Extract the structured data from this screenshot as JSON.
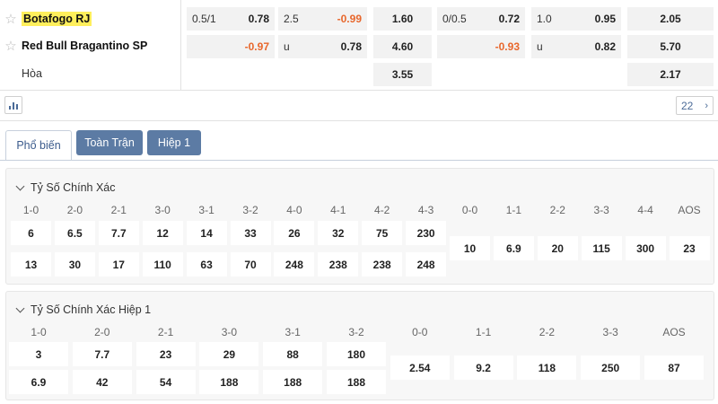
{
  "teams": [
    {
      "name": "Botafogo RJ",
      "highlight": true
    },
    {
      "name": "Red Bull Bragantino SP",
      "highlight": false
    }
  ],
  "draw_label": "Hòa",
  "odds": {
    "row1": {
      "hcap_line": "0.5/1",
      "hcap_odd": "0.78",
      "ou_line": "2.5",
      "ou_odd": "-0.99",
      "x12": "1.60",
      "h1_hcap_line": "0/0.5",
      "h1_hcap_odd": "0.72",
      "h1_ou_line": "1.0",
      "h1_ou_odd": "0.95",
      "h1_x12": "2.05"
    },
    "row2": {
      "hcap_odd": "-0.97",
      "ou_line": "u",
      "ou_odd": "0.78",
      "x12": "4.60",
      "h1_hcap_odd": "-0.93",
      "h1_ou_line": "u",
      "h1_ou_odd": "0.82",
      "h1_x12": "5.70"
    },
    "row3": {
      "x12": "3.55",
      "h1_x12": "2.17"
    }
  },
  "toolbar": {
    "count": "22"
  },
  "tabs": [
    {
      "label": "Phổ biến",
      "active": true
    },
    {
      "label": "Toàn Trận",
      "active": false
    },
    {
      "label": "Hiệp 1",
      "active": false
    }
  ],
  "correct_score": {
    "title": "Tỷ Số Chính Xác",
    "headers": [
      "1-0",
      "2-0",
      "2-1",
      "3-0",
      "3-1",
      "3-2",
      "4-0",
      "4-1",
      "4-2",
      "4-3",
      "0-0",
      "1-1",
      "2-2",
      "3-3",
      "4-4",
      "AOS"
    ],
    "home": [
      "6",
      "6.5",
      "7.7",
      "12",
      "14",
      "33",
      "26",
      "32",
      "75",
      "230"
    ],
    "away": [
      "13",
      "30",
      "17",
      "110",
      "63",
      "70",
      "248",
      "238",
      "238",
      "248"
    ],
    "draws": [
      "10",
      "6.9",
      "20",
      "115",
      "300",
      "23"
    ]
  },
  "correct_score_h1": {
    "title": "Tỷ Số Chính Xác Hiệp 1",
    "headers": [
      "1-0",
      "2-0",
      "2-1",
      "3-0",
      "3-1",
      "3-2",
      "0-0",
      "1-1",
      "2-2",
      "3-3",
      "AOS"
    ],
    "home": [
      "3",
      "7.7",
      "23",
      "29",
      "88",
      "180"
    ],
    "away": [
      "6.9",
      "42",
      "54",
      "188",
      "188",
      "188"
    ],
    "draws": [
      "2.54",
      "9.2",
      "118",
      "250",
      "87"
    ]
  },
  "colors": {
    "negative": "#e8672c",
    "tab_active_text": "#3b5b8c",
    "tab_inactive_bg": "#5c7ba4",
    "highlight": "#ffef5c"
  }
}
